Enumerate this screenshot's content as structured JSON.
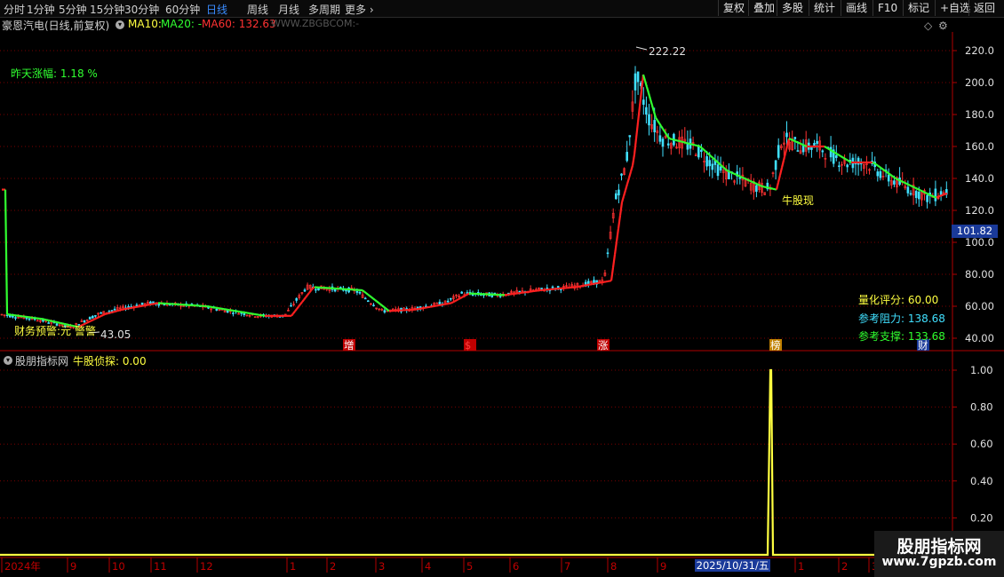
{
  "toolbar": {
    "periods": [
      "分时",
      "1分钟",
      "5分钟",
      "15分钟",
      "30分钟",
      "60分钟",
      "日线",
      "周线",
      "月线",
      "多周期",
      "更多"
    ],
    "active_period": "日线",
    "right_buttons": [
      "复权",
      "叠加",
      "多股",
      "统计",
      "画线",
      "F10",
      "标记",
      "+自选",
      "返回"
    ]
  },
  "main_panel": {
    "stock_title": "豪恩汽电(日线,前复权)",
    "ma10_label": "MA10: ",
    "ma20_label": "MA20: -",
    "ma60_label": "MA60: 132.63",
    "site_label": "WWW.ZBGBCOM:-",
    "yesterday_change": "昨天涨幅: 1.18 %",
    "high_label": "222.22",
    "low_label": "43.05",
    "bull_label": "牛股现",
    "finance_warning": "财务预警:元 警警",
    "score": "量化评分: 60.00",
    "resistance": "参考阻力: 138.68",
    "support": "参考支撑: 133.68",
    "current_price": "101.82",
    "event_markers": [
      "增",
      "$",
      "涨",
      "榜",
      "财"
    ],
    "y_ticks": [
      "220.0",
      "200.0",
      "180.0",
      "160.0",
      "140.0",
      "120.0",
      "100.0",
      "80.00",
      "60.00",
      "40.00"
    ]
  },
  "sub_panel": {
    "indicator_name": "股朋指标网",
    "indicator_value": "牛股侦探: 0.00",
    "y_ticks": [
      "1.00",
      "0.80",
      "0.60",
      "0.40",
      "0.20"
    ]
  },
  "x_axis": {
    "labels": [
      "2024年",
      "9",
      "10",
      "11",
      "12",
      "1",
      "2",
      "3",
      "4",
      "5",
      "6",
      "7",
      "8",
      "9",
      "10",
      "1",
      "2",
      "3"
    ],
    "cursor_date": "2025/10/31/五"
  },
  "watermark": {
    "line1": "股朋指标网",
    "line2": "www.7gpzb.com"
  },
  "colors": {
    "up": "#ff3232",
    "down": "#00e600",
    "ma_up": "#ff2020",
    "ma_down": "#30ff30",
    "indicator": "#ffff40",
    "grid": "#7a0000"
  },
  "chart_data": {
    "type": "line",
    "title": "豪恩汽电(日线,前复权)",
    "ylim": [
      40,
      225
    ],
    "price_key_points": [
      {
        "x": "2024年",
        "close": 55
      },
      {
        "x": "9",
        "close": 47
      },
      {
        "x": "10",
        "close": 60
      },
      {
        "x": "11",
        "close": 62
      },
      {
        "x": "12",
        "close": 60
      },
      {
        "x": "1",
        "close": 54
      },
      {
        "x": "2",
        "close": 72
      },
      {
        "x": "3",
        "close": 70
      },
      {
        "x": "4",
        "close": 55
      },
      {
        "x": "5",
        "close": 62
      },
      {
        "x": "6",
        "close": 68
      },
      {
        "x": "7",
        "close": 70
      },
      {
        "x": "8",
        "close": 74
      },
      {
        "x": "9",
        "close": 140
      },
      {
        "x": "10",
        "close": 222.22
      },
      {
        "x": "2025/10/31/五",
        "close": 133
      },
      {
        "x": "1",
        "close": 160
      },
      {
        "x": "2",
        "close": 140
      },
      {
        "x": "3",
        "close": 133
      }
    ],
    "indicator_series": {
      "name": "牛股侦探",
      "spike_at": "2025/10/31/五",
      "max": 1.0,
      "baseline": 0.0
    }
  }
}
